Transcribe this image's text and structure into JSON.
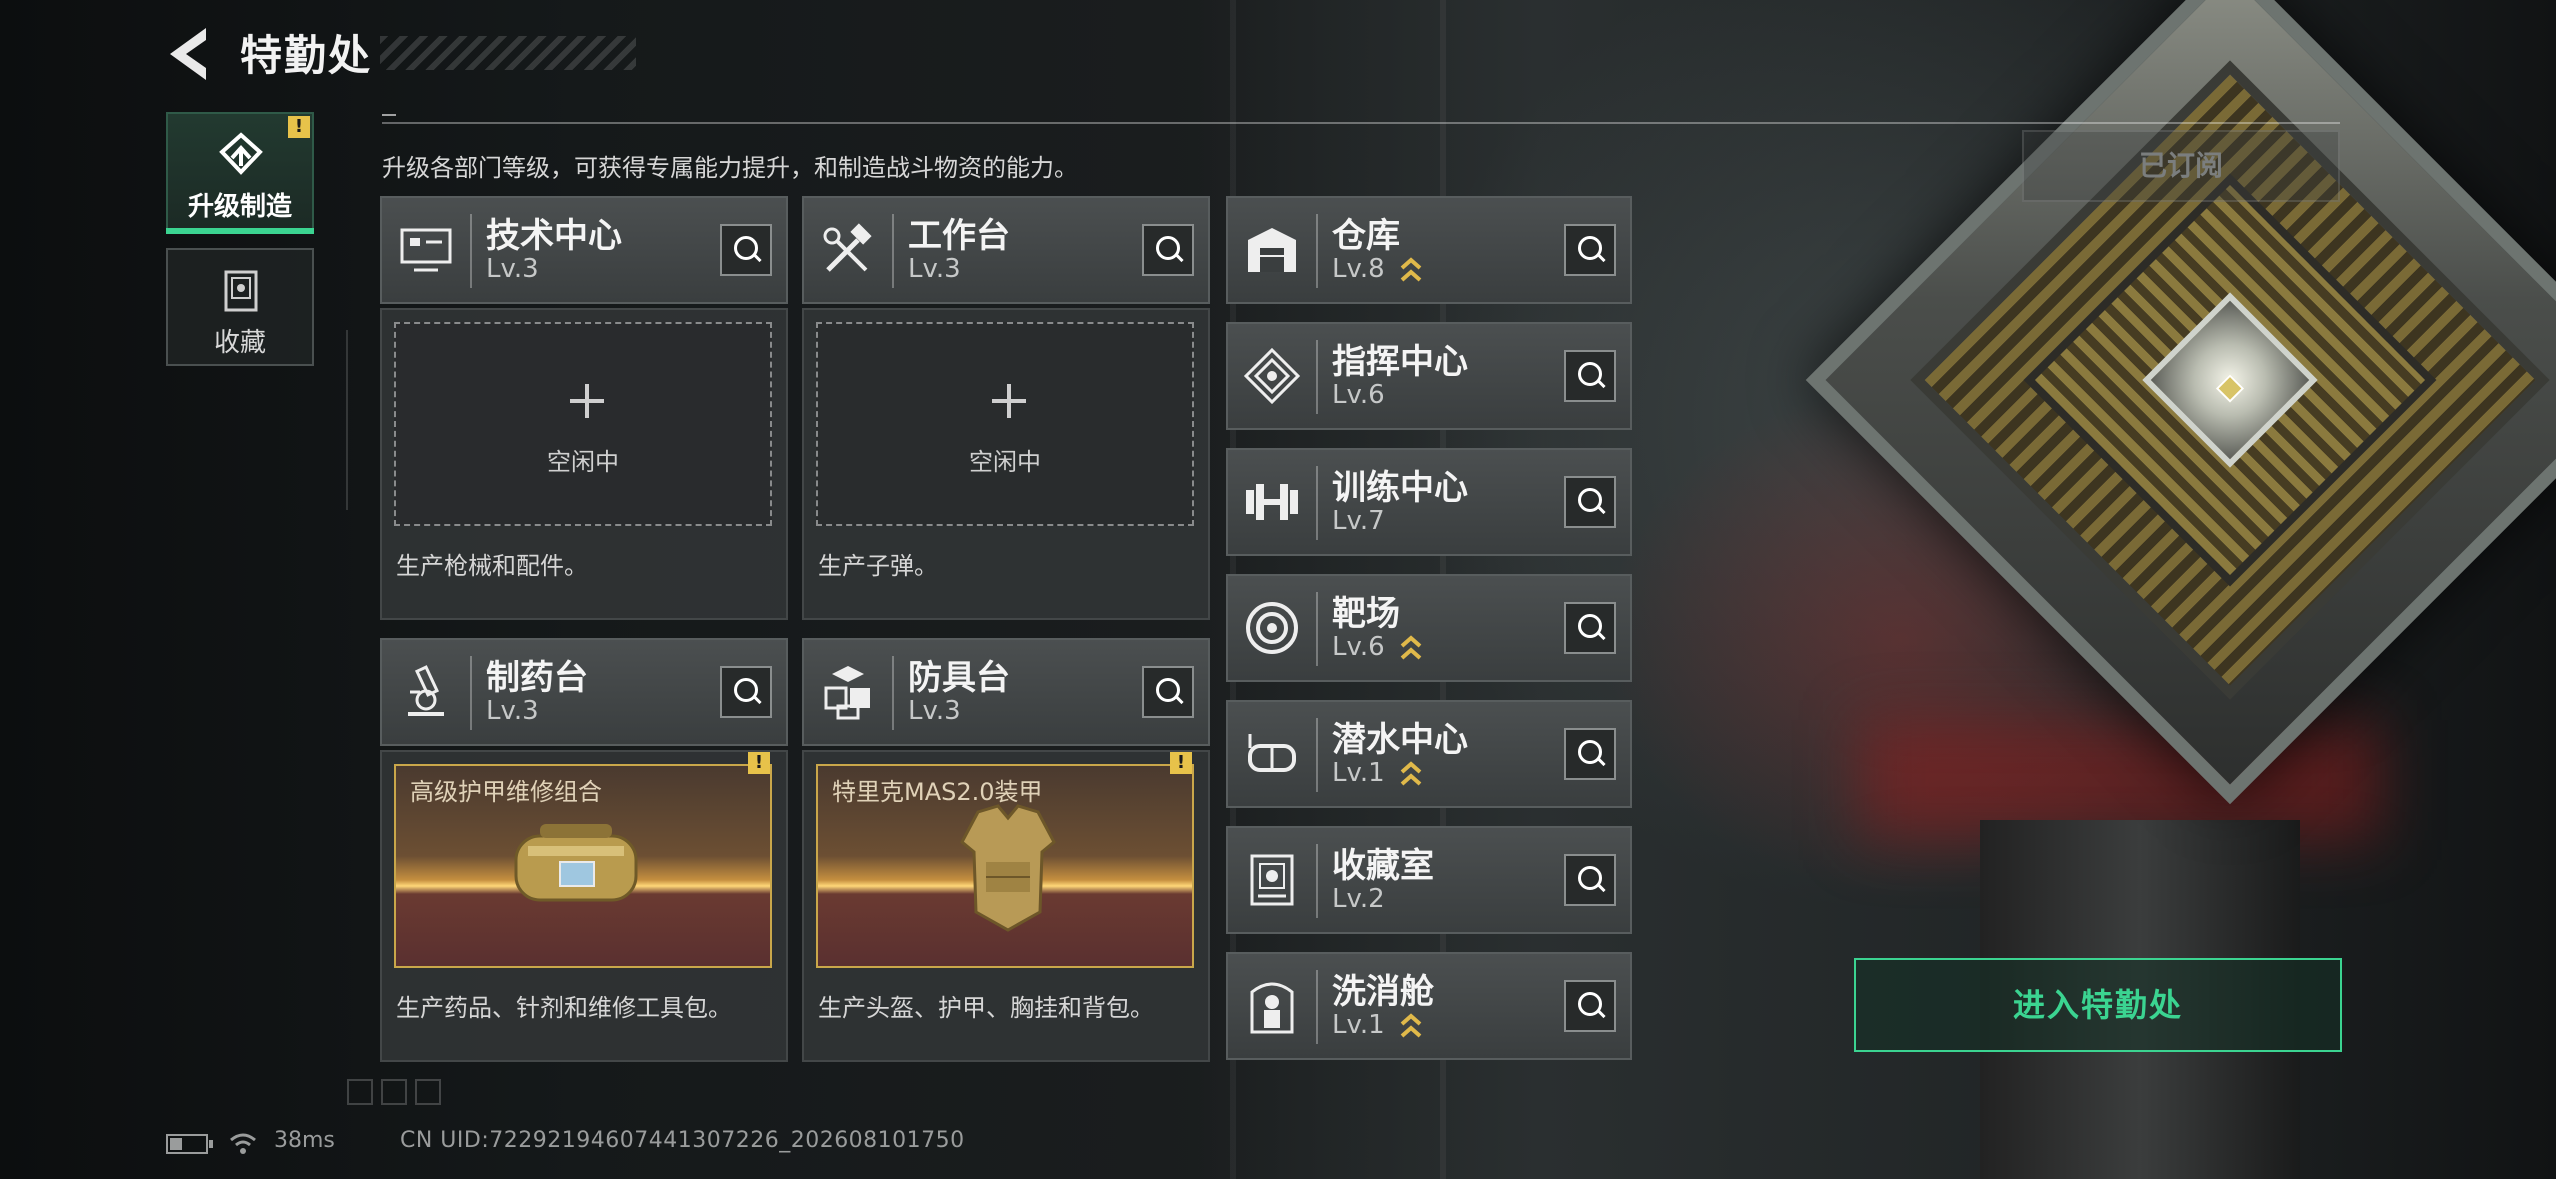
{
  "header": {
    "title": "特勤处",
    "back_icon": "back-arrow-icon"
  },
  "tabs": [
    {
      "label": "升级制造",
      "icon": "upgrade-icon",
      "active": true,
      "badge": "!"
    },
    {
      "label": "收藏",
      "icon": "collection-icon",
      "active": false
    }
  ],
  "description": "升级各部门等级，可获得专属能力提升，和制造战斗物资的能力。",
  "subscribed_label": "已订阅",
  "workshops": [
    {
      "name": "技术中心",
      "level": "Lv.3",
      "icon": "monitor-icon",
      "state": "idle",
      "idle_text": "空闲中",
      "desc": "生产枪械和配件。"
    },
    {
      "name": "工作台",
      "level": "Lv.3",
      "icon": "tools-icon",
      "state": "idle",
      "idle_text": "空闲中",
      "desc": "生产子弹。"
    },
    {
      "name": "制药台",
      "level": "Lv.3",
      "icon": "microscope-icon",
      "state": "item",
      "item_name": "高级护甲维修组合",
      "badge": "!",
      "desc": "生产药品、针剂和维修工具包。"
    },
    {
      "name": "防具台",
      "level": "Lv.3",
      "icon": "boxes-icon",
      "state": "item",
      "item_name": "特里克MAS2.0装甲",
      "badge": "!",
      "desc": "生产头盔、护甲、胸挂和背包。"
    }
  ],
  "facilities": [
    {
      "name": "仓库",
      "level": "Lv.8",
      "icon": "warehouse-icon",
      "upgradable": true
    },
    {
      "name": "指挥中心",
      "level": "Lv.6",
      "icon": "command-icon",
      "upgradable": false
    },
    {
      "name": "训练中心",
      "level": "Lv.7",
      "icon": "dumbbell-icon",
      "upgradable": false
    },
    {
      "name": "靶场",
      "level": "Lv.6",
      "icon": "target-icon",
      "upgradable": true
    },
    {
      "name": "潜水中心",
      "level": "Lv.1",
      "icon": "diving-mask-icon",
      "upgradable": true
    },
    {
      "name": "收藏室",
      "level": "Lv.2",
      "icon": "collection-room-icon",
      "upgradable": false
    },
    {
      "name": "洗消舱",
      "level": "Lv.1",
      "icon": "decontamination-icon",
      "upgradable": true
    }
  ],
  "enter_button": "进入特勤处",
  "status": {
    "ping": "38ms",
    "uid": "CN UID:72292194607441307226_202608101750"
  },
  "colors": {
    "accent_green": "#3bd491",
    "badge_yellow": "#e7c24a",
    "upgrade_gold": "#e0b94a"
  }
}
